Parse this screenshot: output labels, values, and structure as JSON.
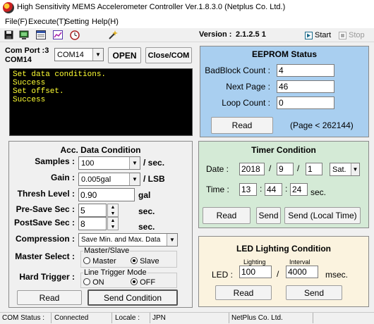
{
  "window": {
    "title": "High Sensitivity MEMS Accelerometer Controller Ver.1.8.3.0 (Netplus Co. Ltd.)"
  },
  "menu": [
    "File(F)",
    "Execute(T)",
    "Setting",
    "Help(H)"
  ],
  "toolbar": {
    "icons": [
      "save-icon",
      "monitor-icon",
      "list-icon",
      "chart-icon",
      "clock-icon",
      "magic-wand-icon"
    ],
    "version_label": "Version :",
    "version_value": "2.1.2.5  1",
    "start_label": "Start",
    "stop_label": "Stop"
  },
  "com": {
    "port_line1": "Com Port :3",
    "port_line2": "COM14",
    "selected": "COM14",
    "open_label": "OPEN",
    "close_label": "Close/COM"
  },
  "console": {
    "lines": [
      "Set data conditions.",
      "Success",
      "Set offset.",
      "Success"
    ]
  },
  "eeprom": {
    "title": "EEPROM Status",
    "badblock_label": "BadBlock Count :",
    "badblock_value": "4",
    "nextpage_label": "Next Page :",
    "nextpage_value": "46",
    "loop_label": "Loop Count :",
    "loop_value": "0",
    "read_label": "Read",
    "page_note": "(Page < 262144)",
    "bg_color": "#a9cff0"
  },
  "acc": {
    "title": "Acc. Data Condition",
    "samples_label": "Samples :",
    "samples_value": "100",
    "samples_unit": "/ sec.",
    "gain_label": "Gain :",
    "gain_value": "0.005gal",
    "gain_unit": "/ LSB",
    "thresh_label": "Thresh Level :",
    "thresh_value": "0.90",
    "thresh_unit": "gal",
    "presave_label": "Pre-Save Sec :",
    "presave_value": "5",
    "presave_unit": "sec.",
    "postsave_label": "PostSave Sec :",
    "postsave_value": "8",
    "postsave_unit": "sec.",
    "compression_label": "Compression :",
    "compression_value": "Save Min. and Max. Data",
    "master_label": "Master Select :",
    "master_group": "Master/Slave",
    "master_opt": "Master",
    "slave_opt": "Slave",
    "trigger_label": "Hard Trigger :",
    "trigger_group": "Line Trigger Mode",
    "on_opt": "ON",
    "off_opt": "OFF",
    "read_label": "Read",
    "send_label": "Send Condition"
  },
  "timer": {
    "title": "Timer Condition",
    "date_label": "Date :",
    "year": "2018",
    "month": "9",
    "day": "1",
    "weekday": "Sat.",
    "time_label": "Time :",
    "hour": "13",
    "minute": "44",
    "second": "24",
    "sec_unit": "sec.",
    "slash": "/",
    "colon": ":",
    "read_label": "Read",
    "send_label": "Send",
    "send_local_label": "Send (Local Time)",
    "bg_color": "#d4ead6"
  },
  "led": {
    "title": "LED Lighting Condition",
    "lighting_label": "Lighting",
    "interval_label": "Interval",
    "led_label": "LED :",
    "lighting_value": "100",
    "interval_value": "4000",
    "slash": "/",
    "unit": "msec.",
    "read_label": "Read",
    "send_label": "Send",
    "bg_color": "#fbf3df"
  },
  "status": {
    "com_label": "COM Status :",
    "com_value": "Connected",
    "locale_label": "Locale :",
    "locale_value": "JPN",
    "company": "NetPlus Co. Ltd."
  }
}
